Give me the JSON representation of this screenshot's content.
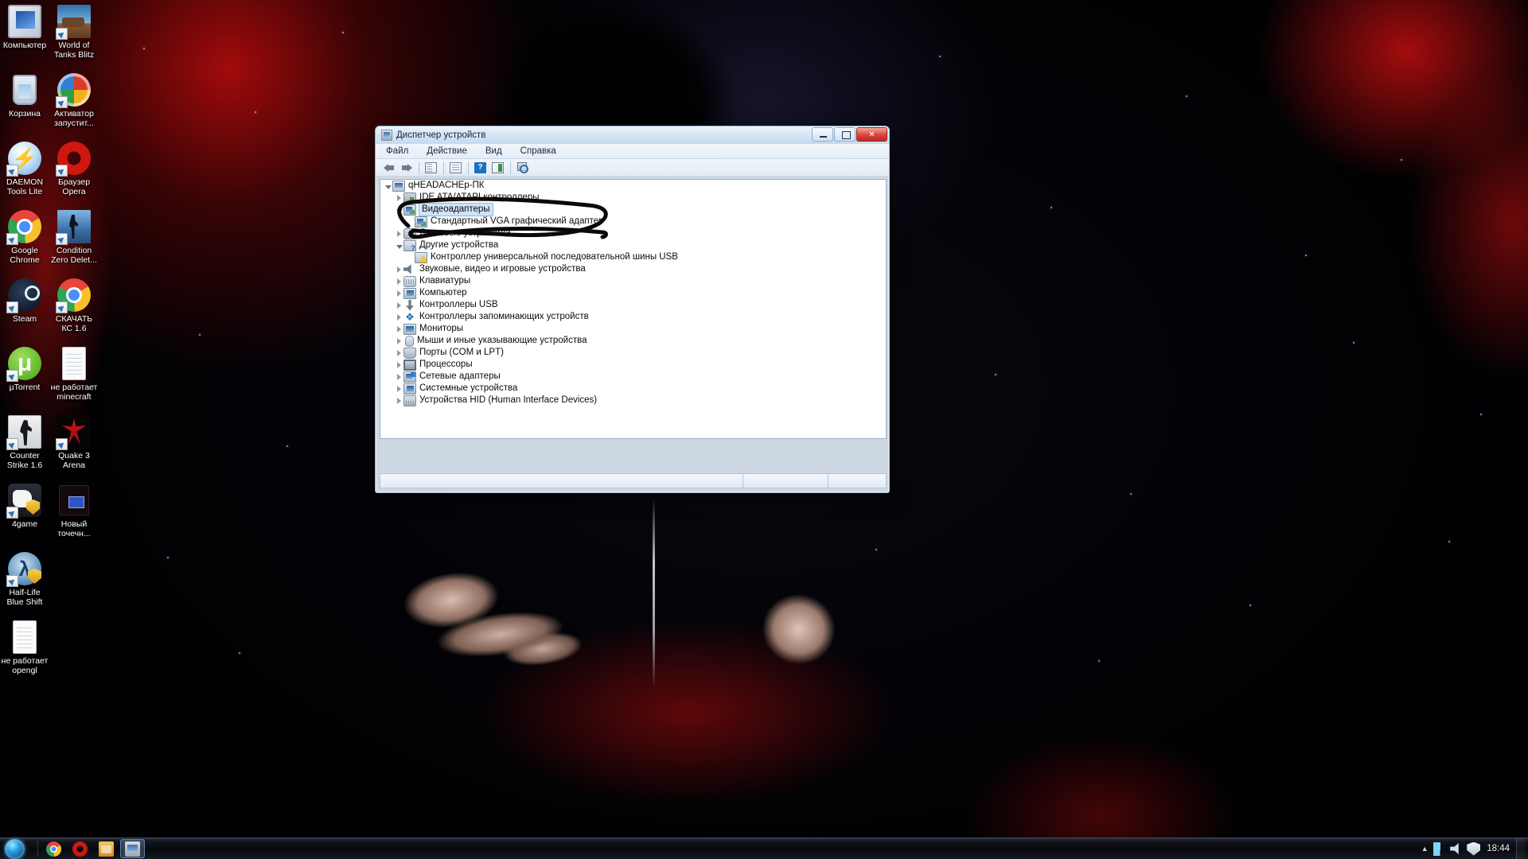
{
  "desktop": {
    "icons": [
      {
        "label": "Компьютер",
        "icon": "computer-icon"
      },
      {
        "label": "World of Tanks Blitz",
        "icon": "world-of-tanks-blitz-icon"
      },
      {
        "label": "Корзина",
        "icon": "recycle-bin-icon"
      },
      {
        "label": "Активатор запустит...",
        "icon": "activator-icon"
      },
      {
        "label": "DAEMON Tools Lite",
        "icon": "daemon-tools-icon"
      },
      {
        "label": "Браузер Opera",
        "icon": "opera-icon"
      },
      {
        "label": "Google Chrome",
        "icon": "chrome-icon"
      },
      {
        "label": "Condition Zero Delet...",
        "icon": "condition-zero-icon"
      },
      {
        "label": "Steam",
        "icon": "steam-icon"
      },
      {
        "label": "СКАЧАТЬ КС 1.6",
        "icon": "chrome-icon"
      },
      {
        "label": "µTorrent",
        "icon": "utorrent-icon"
      },
      {
        "label": "не работает minecraft",
        "icon": "text-file-icon"
      },
      {
        "label": "Counter Strike 1.6",
        "icon": "counter-strike-icon"
      },
      {
        "label": "Quake 3 Arena",
        "icon": "quake-icon"
      },
      {
        "label": "4game",
        "icon": "4game-icon"
      },
      {
        "label": "Новый точечн...",
        "icon": "bitmap-image-icon"
      },
      {
        "label": "Half-Life Blue Shift",
        "icon": "half-life-icon"
      },
      {
        "label": "не работает opengl",
        "icon": "text-file-icon"
      }
    ]
  },
  "window": {
    "title": "Диспетчер устройств",
    "title_icon": "device-manager-icon",
    "buttons": {
      "minimize": "minimize-icon",
      "maximize": "maximize-icon",
      "close": "✕"
    },
    "menu": [
      "Файл",
      "Действие",
      "Вид",
      "Справка"
    ],
    "toolbar": [
      {
        "name": "back-button",
        "icon": "arrow-left-icon"
      },
      {
        "name": "forward-button",
        "icon": "arrow-right-icon"
      },
      {
        "name": "show-hidden-devices-button",
        "icon": "list-icon"
      },
      {
        "name": "properties-button",
        "icon": "properties-icon"
      },
      {
        "name": "help-button",
        "icon": "question-mark-icon"
      },
      {
        "name": "update-driver-button",
        "icon": "update-driver-icon"
      },
      {
        "name": "scan-hardware-changes-button",
        "icon": "scan-icon"
      }
    ],
    "tree": [
      {
        "label": "qHEADACHEp-ПК",
        "level": 0,
        "state": "expanded",
        "icon": "computer-tree-icon",
        "selected": false
      },
      {
        "label": "IDE ATA/ATAPI контроллеры",
        "level": 1,
        "state": "collapsed",
        "icon": "ide-controller-icon",
        "selected": false
      },
      {
        "label": "Видеоадаптеры",
        "level": 1,
        "state": "expanded",
        "icon": "display-adapter-icon",
        "selected": true
      },
      {
        "label": "Стандартный VGA графический адаптер",
        "level": 2,
        "state": "leaf",
        "icon": "display-adapter-icon",
        "selected": false
      },
      {
        "label": "Дисковые устройства",
        "level": 1,
        "state": "collapsed",
        "icon": "disk-drive-icon",
        "selected": false
      },
      {
        "label": "Другие устройства",
        "level": 1,
        "state": "expanded",
        "icon": "other-devices-icon",
        "selected": false
      },
      {
        "label": "Контроллер универсальной последовательной шины USB",
        "level": 2,
        "state": "leaf",
        "icon": "warning-device-icon",
        "selected": false
      },
      {
        "label": "Звуковые, видео и игровые устройства",
        "level": 1,
        "state": "collapsed",
        "icon": "sound-device-icon",
        "selected": false
      },
      {
        "label": "Клавиатуры",
        "level": 1,
        "state": "collapsed",
        "icon": "keyboard-icon",
        "selected": false
      },
      {
        "label": "Компьютер",
        "level": 1,
        "state": "collapsed",
        "icon": "computer-icon",
        "selected": false
      },
      {
        "label": "Контроллеры USB",
        "level": 1,
        "state": "collapsed",
        "icon": "usb-controller-icon",
        "selected": false
      },
      {
        "label": "Контроллеры запоминающих устройств",
        "level": 1,
        "state": "collapsed",
        "icon": "storage-controller-icon",
        "selected": false
      },
      {
        "label": "Мониторы",
        "level": 1,
        "state": "collapsed",
        "icon": "monitor-icon",
        "selected": false
      },
      {
        "label": "Мыши и иные указывающие устройства",
        "level": 1,
        "state": "collapsed",
        "icon": "mouse-icon",
        "selected": false
      },
      {
        "label": "Порты (COM и LPT)",
        "level": 1,
        "state": "collapsed",
        "icon": "port-icon",
        "selected": false
      },
      {
        "label": "Процессоры",
        "level": 1,
        "state": "collapsed",
        "icon": "processor-icon",
        "selected": false
      },
      {
        "label": "Сетевые адаптеры",
        "level": 1,
        "state": "collapsed",
        "icon": "network-adapter-icon",
        "selected": false
      },
      {
        "label": "Системные устройства",
        "level": 1,
        "state": "collapsed",
        "icon": "system-device-icon",
        "selected": false
      },
      {
        "label": "Устройства HID (Human Interface Devices)",
        "level": 1,
        "state": "collapsed",
        "icon": "hid-device-icon",
        "selected": false
      }
    ],
    "annotation": {
      "shape": "hand-drawn-oval",
      "color": "#0a0a0a"
    }
  },
  "taskbar": {
    "start": "start-orb-icon",
    "pinned": [
      {
        "name": "taskbar-chrome",
        "icon": "chrome-icon"
      },
      {
        "name": "taskbar-opera",
        "icon": "opera-icon"
      },
      {
        "name": "taskbar-explorer",
        "icon": "folder-icon"
      }
    ],
    "running": [
      {
        "name": "taskbar-device-manager",
        "icon": "device-manager-icon",
        "active": true
      }
    ],
    "tray": {
      "overflow": "▲",
      "icons": [
        {
          "name": "tray-network-icon"
        },
        {
          "name": "tray-volume-icon"
        },
        {
          "name": "tray-action-center-icon"
        }
      ],
      "clock": "18:44"
    }
  },
  "colors": {
    "accent": "#2f7fd4",
    "selection": "#cfe4f7",
    "close_button": "#d8443a",
    "annotation": "#0a0a0a"
  }
}
